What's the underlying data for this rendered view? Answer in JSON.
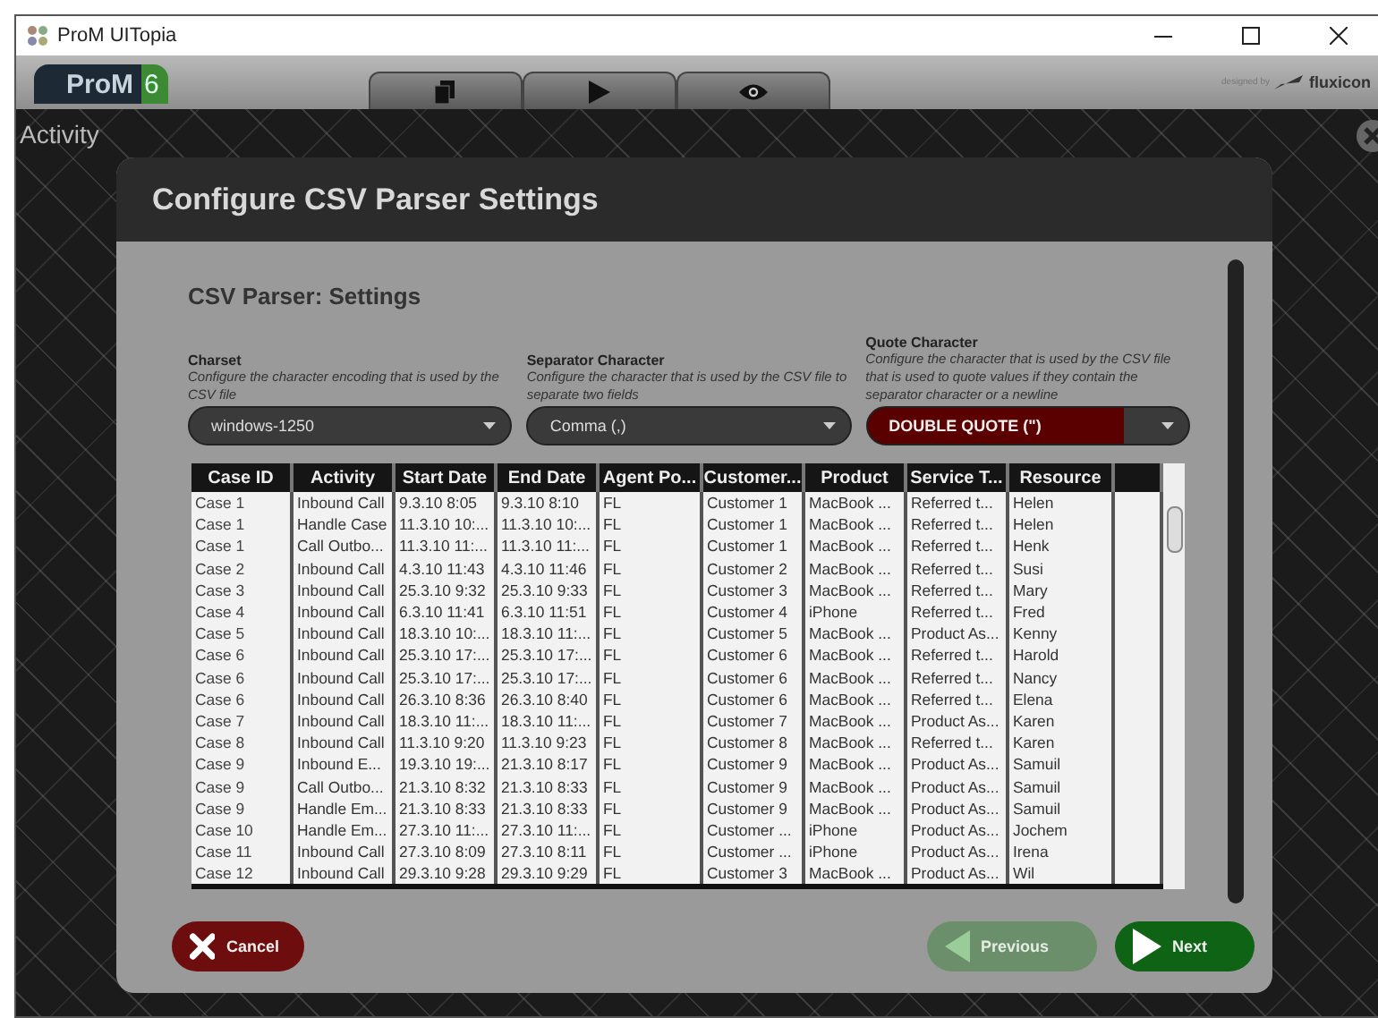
{
  "window": {
    "title": "ProM UITopia"
  },
  "logo": {
    "name": "ProM",
    "version": "6"
  },
  "toolbar_tabs": [
    {
      "kind": "workspace"
    },
    {
      "kind": "actions"
    },
    {
      "kind": "views"
    }
  ],
  "credit": {
    "prefix": "designed by",
    "brand": "fluxicon"
  },
  "side_label": "Activity",
  "dialog": {
    "title": "Configure CSV Parser Settings",
    "section_title": "CSV Parser: Settings",
    "fields": [
      {
        "label": "Charset",
        "description": "Configure the character encoding that is used by the CSV file",
        "value": "windows-1250",
        "focused": false
      },
      {
        "label": "Separator Character",
        "description": "Configure the character that is used by the CSV file to separate two fields",
        "value": "Comma (,)",
        "focused": false
      },
      {
        "label": "Quote Character",
        "description": "Configure the character that is used by the CSV file that is used to quote values if they contain the separator character or a newline",
        "value": "DOUBLE QUOTE (\")",
        "focused": true
      }
    ],
    "table": {
      "columns": [
        "Case ID",
        "Activity",
        "Start Date",
        "End Date",
        "Agent Po...",
        "Customer...",
        "Product",
        "Service T...",
        "Resource"
      ],
      "rows": [
        [
          "Case 1",
          "Inbound Call",
          "9.3.10 8:05",
          "9.3.10 8:10",
          "FL",
          "Customer 1",
          "MacBook ...",
          "Referred t...",
          "Helen"
        ],
        [
          "Case 1",
          "Handle Case",
          "11.3.10 10:...",
          "11.3.10 10:...",
          "FL",
          "Customer 1",
          "MacBook ...",
          "Referred t...",
          "Helen"
        ],
        [
          "Case 1",
          "Call Outbo...",
          "11.3.10 11:...",
          "11.3.10 11:...",
          "FL",
          "Customer 1",
          "MacBook ...",
          "Referred t...",
          "Henk"
        ],
        [
          "Case 2",
          "Inbound Call",
          "4.3.10 11:43",
          "4.3.10 11:46",
          "FL",
          "Customer 2",
          "MacBook ...",
          "Referred t...",
          "Susi"
        ],
        [
          "Case 3",
          "Inbound Call",
          "25.3.10 9:32",
          "25.3.10 9:33",
          "FL",
          "Customer 3",
          "MacBook ...",
          "Referred t...",
          "Mary"
        ],
        [
          "Case 4",
          "Inbound Call",
          "6.3.10 11:41",
          "6.3.10 11:51",
          "FL",
          "Customer 4",
          "iPhone",
          "Referred t...",
          "Fred"
        ],
        [
          "Case 5",
          "Inbound Call",
          "18.3.10 10:...",
          "18.3.10 11:...",
          "FL",
          "Customer 5",
          "MacBook ...",
          "Product As...",
          "Kenny"
        ],
        [
          "Case 6",
          "Inbound Call",
          "25.3.10 17:...",
          "25.3.10 17:...",
          "FL",
          "Customer 6",
          "MacBook ...",
          "Referred t...",
          "Harold"
        ],
        [
          "Case 6",
          "Inbound Call",
          "25.3.10 17:...",
          "25.3.10 17:...",
          "FL",
          "Customer 6",
          "MacBook ...",
          "Referred t...",
          "Nancy"
        ],
        [
          "Case 6",
          "Inbound Call",
          "26.3.10 8:36",
          "26.3.10 8:40",
          "FL",
          "Customer 6",
          "MacBook ...",
          "Referred t...",
          "Elena"
        ],
        [
          "Case 7",
          "Inbound Call",
          "18.3.10 11:...",
          "18.3.10 11:...",
          "FL",
          "Customer 7",
          "MacBook ...",
          "Product As...",
          "Karen"
        ],
        [
          "Case 8",
          "Inbound Call",
          "11.3.10 9:20",
          "11.3.10 9:23",
          "FL",
          "Customer 8",
          "MacBook ...",
          "Referred t...",
          "Karen"
        ],
        [
          "Case 9",
          "Inbound E...",
          "19.3.10 19:...",
          "21.3.10 8:17",
          "FL",
          "Customer 9",
          "MacBook ...",
          "Product As...",
          "Samuil"
        ],
        [
          "Case 9",
          "Call Outbo...",
          "21.3.10 8:32",
          "21.3.10 8:33",
          "FL",
          "Customer 9",
          "MacBook ...",
          "Product As...",
          "Samuil"
        ],
        [
          "Case 9",
          "Handle Em...",
          "21.3.10 8:33",
          "21.3.10 8:33",
          "FL",
          "Customer 9",
          "MacBook ...",
          "Product As...",
          "Samuil"
        ],
        [
          "Case 10",
          "Handle Em...",
          "27.3.10 11:...",
          "27.3.10 11:...",
          "FL",
          "Customer ...",
          "iPhone",
          "Product As...",
          "Jochem"
        ],
        [
          "Case 11",
          "Inbound Call",
          "27.3.10 8:09",
          "27.3.10 8:11",
          "FL",
          "Customer ...",
          "iPhone",
          "Product As...",
          "Irena"
        ],
        [
          "Case 12",
          "Inbound Call",
          "29.3.10 9:28",
          "29.3.10 9:29",
          "FL",
          "Customer 3",
          "MacBook ...",
          "Product As...",
          "Wil"
        ]
      ]
    },
    "buttons": [
      {
        "kind": "cancel",
        "label": "Cancel",
        "disabled": false
      },
      {
        "kind": "previous",
        "label": "Previous",
        "disabled": true
      },
      {
        "kind": "next",
        "label": "Next",
        "disabled": false
      }
    ]
  }
}
